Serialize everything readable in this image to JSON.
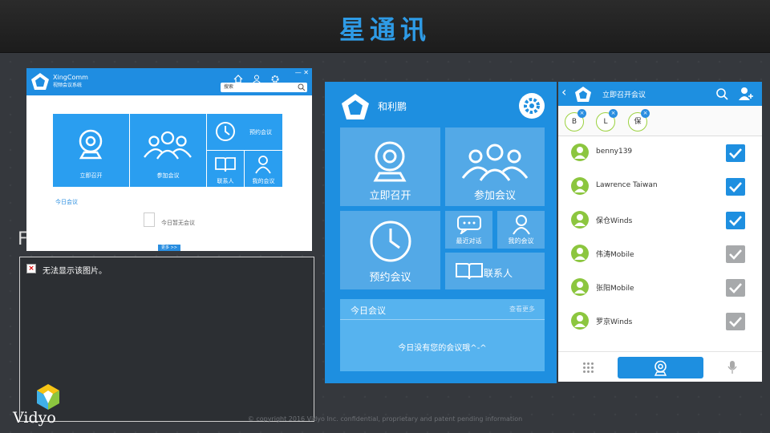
{
  "slide": {
    "title": "星通讯",
    "left_fragment": "F",
    "broken_image_text": "无法显示该图片。",
    "vidyo": "Vidyo",
    "copyright": "© copyright 2016 Vidyo Inc. confidential, proprietary and patent pending information"
  },
  "desktop": {
    "brand": "XingComm",
    "brand_sub": "视频会议系统",
    "window_controls": "— ✕",
    "search_placeholder": "搜索",
    "tiles": {
      "start": "立即召开",
      "join": "参加会议",
      "schedule": "预约会议",
      "contacts": "联系人",
      "my_meetings": "我的会议"
    },
    "today_label": "今日会议",
    "empty_text": "今日暂无会议",
    "more_button": "更多 >>"
  },
  "tablet": {
    "user_name": "和利鹏",
    "tiles": {
      "start": "立即召开",
      "join": "参加会议",
      "schedule": "预约会议",
      "recent": "最近对话",
      "my_meetings": "我的会议",
      "contacts": "联系人"
    },
    "today_header": "今日会议",
    "see_more": "查看更多",
    "empty_text": "今日没有您的会议哦^-^"
  },
  "phone": {
    "title": "立即召开会议",
    "selected": [
      {
        "label": "B"
      },
      {
        "label": "L"
      },
      {
        "label": "保"
      }
    ],
    "contacts": [
      {
        "name": "benny139",
        "checked": true
      },
      {
        "name": "Lawrence Taiwan",
        "checked": true
      },
      {
        "name": "保仓Winds",
        "checked": true
      },
      {
        "name": "伟涛Mobile",
        "checked": false
      },
      {
        "name": "张阳Mobile",
        "checked": false
      },
      {
        "name": "罗京Winds",
        "checked": false
      }
    ]
  },
  "colors": {
    "accent": "#1e8fe0",
    "title_blue": "#2e9be6",
    "avatar_green": "#8cc63f",
    "unchecked_gray": "#a7a9ab"
  }
}
